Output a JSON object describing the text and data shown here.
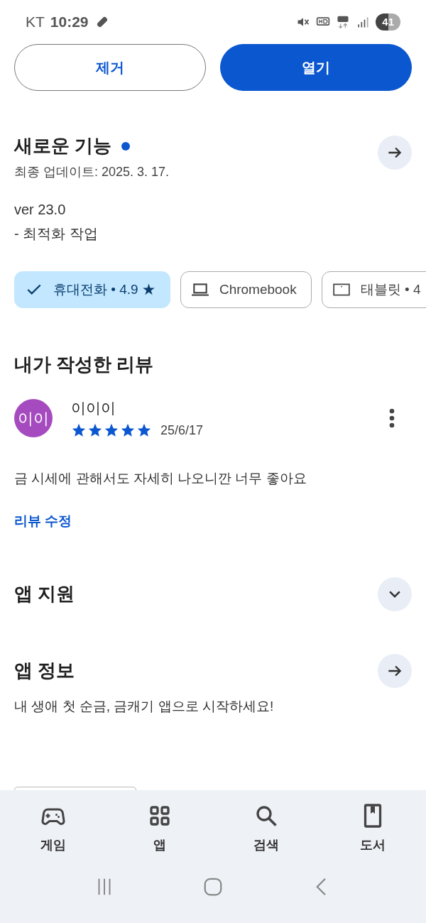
{
  "status_bar": {
    "carrier": "KT",
    "time": "10:29",
    "battery": "41"
  },
  "actions": [
    {
      "label": "제거",
      "kind": "outline"
    },
    {
      "label": "열기",
      "kind": "filled"
    }
  ],
  "whats_new": {
    "title": "새로운 기능",
    "updated": "최종 업데이트: 2025. 3. 17.",
    "lines": [
      "ver 23.0",
      "- 최적화 작업"
    ]
  },
  "device_chips": [
    {
      "label": "휴대전화 • 4.9 ★",
      "selected": true
    },
    {
      "label": "Chromebook",
      "kind": "laptop",
      "selected": false
    },
    {
      "label": "태블릿 • 4",
      "kind": "tablet",
      "selected": false
    }
  ],
  "my_review": {
    "title": "내가 작성한 리뷰",
    "avatar": "이이",
    "author": "이이이",
    "stars": 5,
    "date": "25/6/17",
    "text": "금 시세에 관해서도 자세히 나오니깐 너무 좋아요",
    "edit_link": "리뷰 수정"
  },
  "sections": [
    {
      "title": "앱 지원",
      "kind": "expand"
    },
    {
      "title": "앱 정보",
      "kind": "arrow",
      "description": "내 생애 첫 순금, 금캐기 앱으로 시작하세요!"
    }
  ],
  "bottom_nav": [
    {
      "label": "게임",
      "kind": "games"
    },
    {
      "label": "앱",
      "kind": "apps"
    },
    {
      "label": "검색",
      "kind": "search"
    },
    {
      "label": "도서",
      "kind": "books"
    }
  ]
}
